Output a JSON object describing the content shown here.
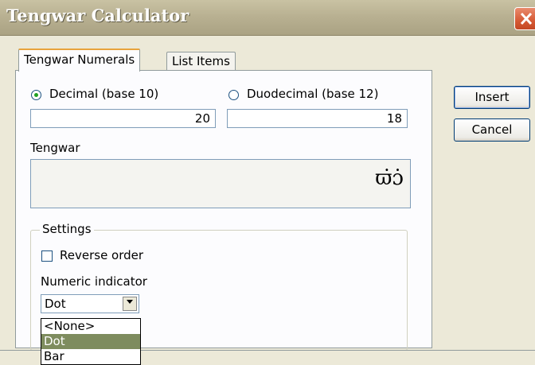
{
  "window": {
    "title": "Tengwar Calculator"
  },
  "tabs": [
    {
      "label": "Tengwar Numerals",
      "active": true
    },
    {
      "label": "List Items",
      "active": false
    }
  ],
  "decimal": {
    "label": "Decimal (base 10)",
    "value": "20",
    "selected": true
  },
  "duodecimal": {
    "label": "Duodecimal (base 12)",
    "value": "18",
    "selected": false
  },
  "buttons": {
    "insert": "Insert",
    "cancel": "Cancel"
  },
  "tengwar": {
    "label": "Tengwar",
    "glyph": "ϖ̇ɔ̇"
  },
  "settings": {
    "title": "Settings",
    "reverse_order_label": "Reverse order",
    "reverse_order_checked": false,
    "numeric_indicator_label": "Numeric indicator",
    "numeric_indicator_value": "Dot",
    "options": [
      "<None>",
      "Dot",
      "Bar"
    ]
  },
  "icons": {
    "close": "close-icon",
    "dropdown": "chevron-down-icon"
  },
  "colors": {
    "selection": "#7e8c5e",
    "titlebar": "#b9b192",
    "close": "#d65a35"
  }
}
